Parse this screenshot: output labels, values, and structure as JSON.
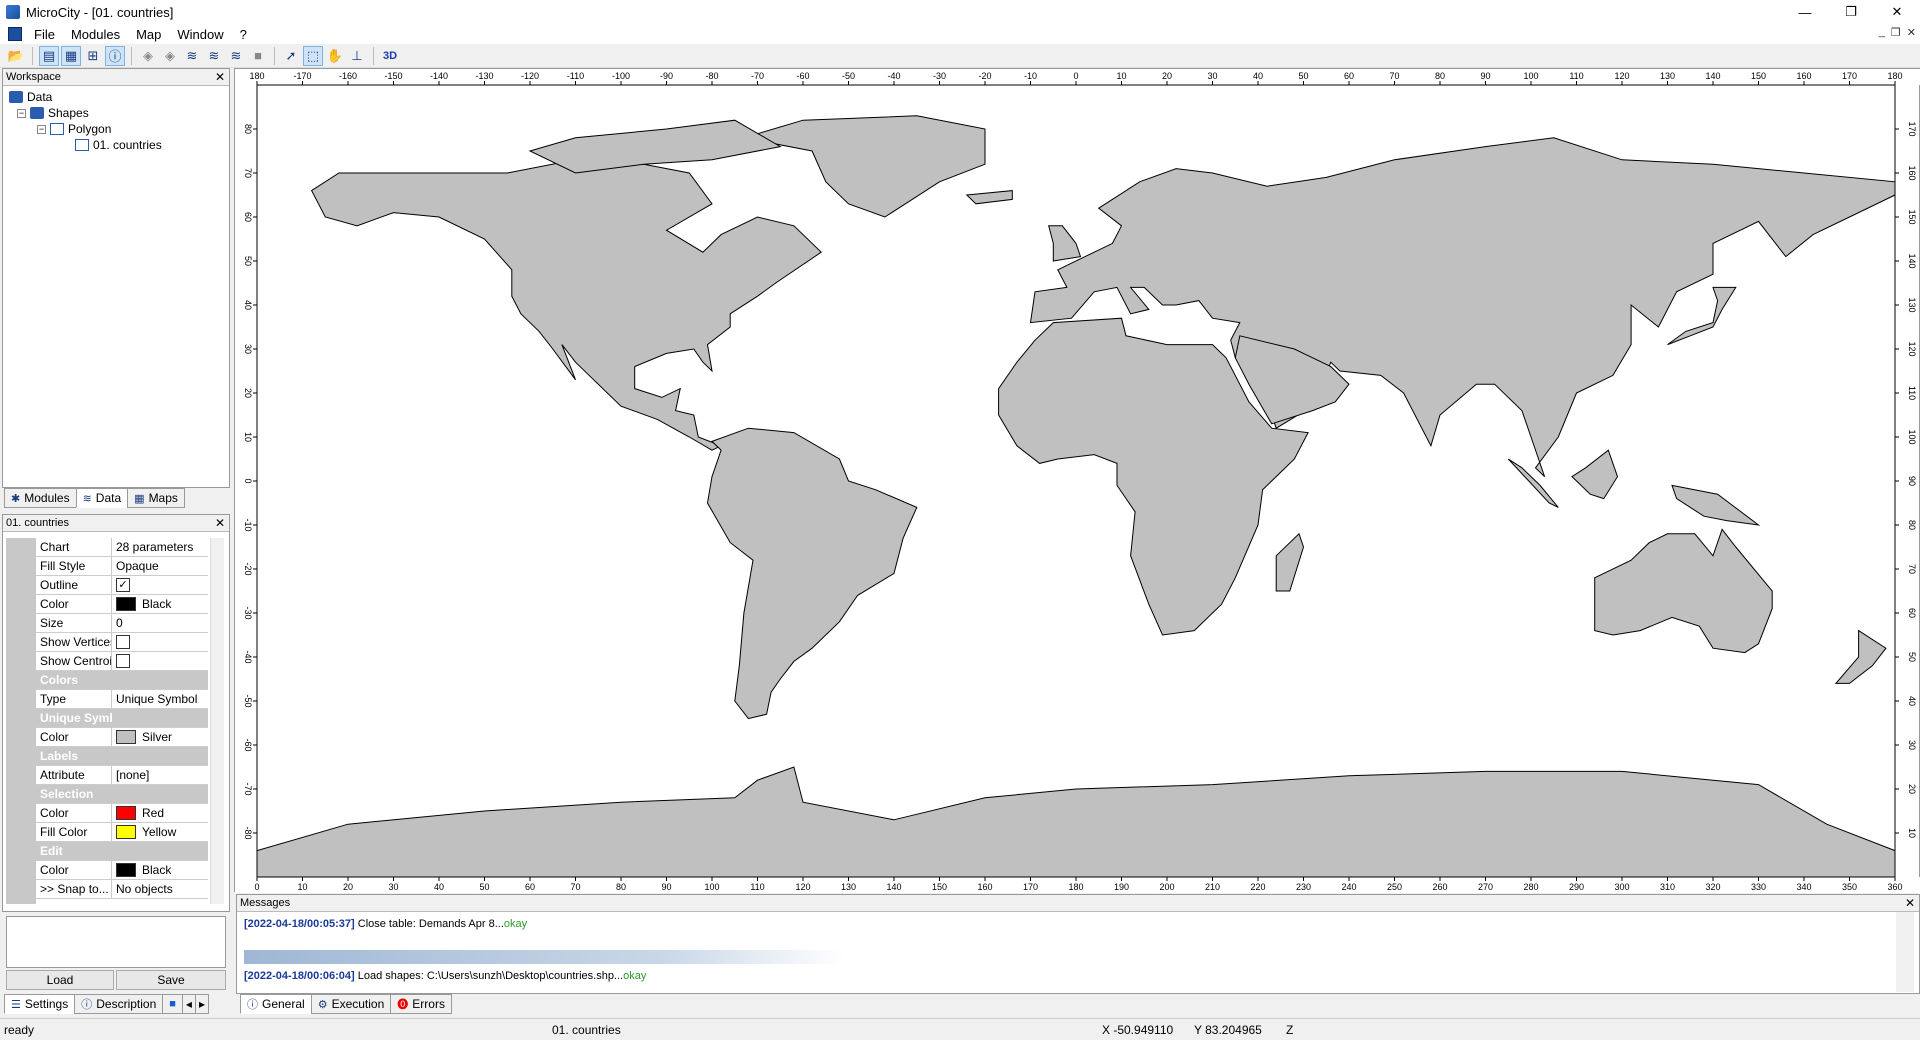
{
  "window": {
    "title": "MicroCity - [01. countries]"
  },
  "menu": [
    "File",
    "Modules",
    "Map",
    "Window",
    "?"
  ],
  "workspace": {
    "title": "Workspace",
    "tree": [
      "Data",
      "Shapes",
      "Polygon",
      "01. countries"
    ],
    "tabs": [
      "Modules",
      "Data",
      "Maps"
    ]
  },
  "properties": {
    "title": "01. countries",
    "rows": [
      {
        "label": "Chart",
        "value": "28 parameters"
      },
      {
        "label": "Fill Style",
        "value": "Opaque"
      },
      {
        "label": "Outline",
        "value": "✓",
        "section_toggle": "⊟"
      },
      {
        "label": "Color",
        "value": "Black",
        "swatch": "#000000"
      },
      {
        "label": "Size",
        "value": "0"
      },
      {
        "label": "Show Vertices",
        "value": ""
      },
      {
        "label": "Show Centroid",
        "value": ""
      },
      {
        "label": "Colors",
        "value": "",
        "section": true
      },
      {
        "label": "Type",
        "value": "Unique Symbol"
      },
      {
        "label": "Unique Symbol",
        "value": "",
        "section": true
      },
      {
        "label": "Color",
        "value": "Silver",
        "swatch": "#c0c0c0"
      },
      {
        "label": "Labels",
        "value": "",
        "section": true
      },
      {
        "label": "Attribute",
        "value": "[none]"
      },
      {
        "label": "Selection",
        "value": "",
        "section": true
      },
      {
        "label": "Color",
        "value": "Red",
        "swatch": "#ff0000"
      },
      {
        "label": "Fill Color",
        "value": "Yellow",
        "swatch": "#ffff00"
      },
      {
        "label": "Edit",
        "value": "",
        "section": true
      },
      {
        "label": "Color",
        "value": "Black",
        "swatch": "#000000"
      },
      {
        "label": ">> Snap to...",
        "value": "No objects"
      }
    ],
    "buttons": {
      "load": "Load",
      "save": "Save"
    },
    "tabs": [
      "Settings",
      "Description"
    ]
  },
  "map": {
    "top_ruler": [
      "180",
      "-170",
      "-160",
      "-150",
      "-140",
      "-130",
      "-120",
      "-110",
      "-100",
      "-90",
      "-80",
      "-70",
      "-60",
      "-50",
      "-40",
      "-30",
      "-20",
      "-10",
      "0",
      "10",
      "20",
      "30",
      "40",
      "50",
      "60",
      "70",
      "80",
      "90",
      "100",
      "110",
      "120",
      "130",
      "140",
      "150",
      "160",
      "170",
      "180"
    ],
    "bottom_ruler": [
      "0",
      "10",
      "20",
      "30",
      "40",
      "50",
      "60",
      "70",
      "80",
      "90",
      "100",
      "110",
      "120",
      "130",
      "140",
      "150",
      "160",
      "170",
      "180",
      "190",
      "200",
      "210",
      "220",
      "230",
      "240",
      "250",
      "260",
      "270",
      "280",
      "290",
      "300",
      "310",
      "320",
      "330",
      "340",
      "350",
      "360"
    ],
    "left_ruler": [
      "80",
      "70",
      "60",
      "50",
      "40",
      "30",
      "20",
      "10",
      "0",
      "-10",
      "-20",
      "-30",
      "-40",
      "-50",
      "-60",
      "-70",
      "-80"
    ],
    "right_ruler": [
      "170",
      "160",
      "150",
      "140",
      "130",
      "120",
      "110",
      "100",
      "90",
      "80",
      "70",
      "60",
      "50",
      "40",
      "30",
      "20",
      "10"
    ],
    "land_color": "#c0c0c0",
    "outline_color": "#000000"
  },
  "messages": {
    "title": "Messages",
    "entries": [
      {
        "ts": "[2022-04-18/00:05:37]",
        "text": " Close table: Demands Apr 8...",
        "status": "okay"
      },
      {
        "ts": "[2022-04-18/00:06:04]",
        "text": " Load shapes: C:\\Users\\sunzh\\Desktop\\countries.shp...",
        "status": "okay"
      }
    ],
    "tabs": [
      "General",
      "Execution",
      "Errors"
    ]
  },
  "status": {
    "state": "ready",
    "layer": "01. countries",
    "x": "X -50.949110",
    "y": "Y 83.204965",
    "z": "Z"
  }
}
